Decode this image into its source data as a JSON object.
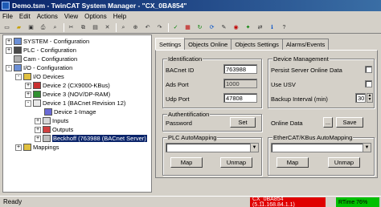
{
  "window": {
    "title": "Demo.tsm - TwinCAT System Manager - \"CX_0BA854\""
  },
  "menu": [
    "File",
    "Edit",
    "Actions",
    "View",
    "Options",
    "Help"
  ],
  "toolbar": {
    "buttons": [
      "new",
      "open",
      "save",
      "print",
      "preview",
      "cut",
      "copy",
      "paste",
      "delete",
      "find",
      "zoom",
      "undo",
      "redo",
      "check",
      "activate",
      "run",
      "config",
      "toggle",
      "target",
      "scan",
      "network",
      "info",
      "help"
    ]
  },
  "tree": [
    {
      "label": "SYSTEM - Configuration",
      "expander": "+"
    },
    {
      "label": "PLC - Configuration",
      "expander": "+"
    },
    {
      "label": "Cam - Configuration",
      "expander": ""
    },
    {
      "label": "I/O - Configuration",
      "expander": "-"
    },
    {
      "label": "I/O Devices",
      "expander": "-"
    },
    {
      "label": "Device 2 (CX9000-KBus)",
      "expander": "+"
    },
    {
      "label": "Device 3 (NOV/DP-RAM)",
      "expander": "+"
    },
    {
      "label": "Device 1 (BACnet Revision 12)",
      "expander": "-"
    },
    {
      "label": "Device 1-Image",
      "expander": ""
    },
    {
      "label": "Inputs",
      "expander": "+"
    },
    {
      "label": "Outputs",
      "expander": "+"
    },
    {
      "label": "Beckhoff (763988 (BACnet Server)",
      "expander": "+"
    },
    {
      "label": "Mappings",
      "expander": "+"
    }
  ],
  "tabs": [
    "Settings",
    "Objects Online",
    "Objects Settings",
    "Alarms/Events"
  ],
  "identification": {
    "title": "Identification",
    "bacnet_id_label": "BACnet ID",
    "bacnet_id_value": "763988",
    "ads_port_label": "Ads Port",
    "ads_port_value": "1000",
    "udp_port_label": "Udp Port",
    "udp_port_value": "47808"
  },
  "device_management": {
    "title": "Device Management",
    "persist_label": "Persist Server Online Data",
    "use_usv_label": "Use USV",
    "backup_interval_label": "Backup Interval (min)",
    "backup_interval_value": "30"
  },
  "authentification": {
    "title": "Authentification",
    "password_label": "Password",
    "set_button": "Set",
    "online_data_label": "Online Data",
    "browse_button": "...",
    "save_button": "Save"
  },
  "plc_automapping": {
    "title": "PLC AutoMapping",
    "map_button": "Map",
    "unmap_button": "Unmap"
  },
  "ethercat_automapping": {
    "title": "EtherCAT/KBus AutoMapping",
    "map_button": "Map",
    "unmap_button": "Unmap"
  },
  "status": {
    "ready": "Ready",
    "target": "CX_0BA854 (5.11.168.84.1.1)",
    "rtime": "RTime 76%"
  },
  "colors": {
    "target_bg": "#e00000",
    "rtime_bg": "#00c000",
    "title_bg": "#0a246a"
  }
}
